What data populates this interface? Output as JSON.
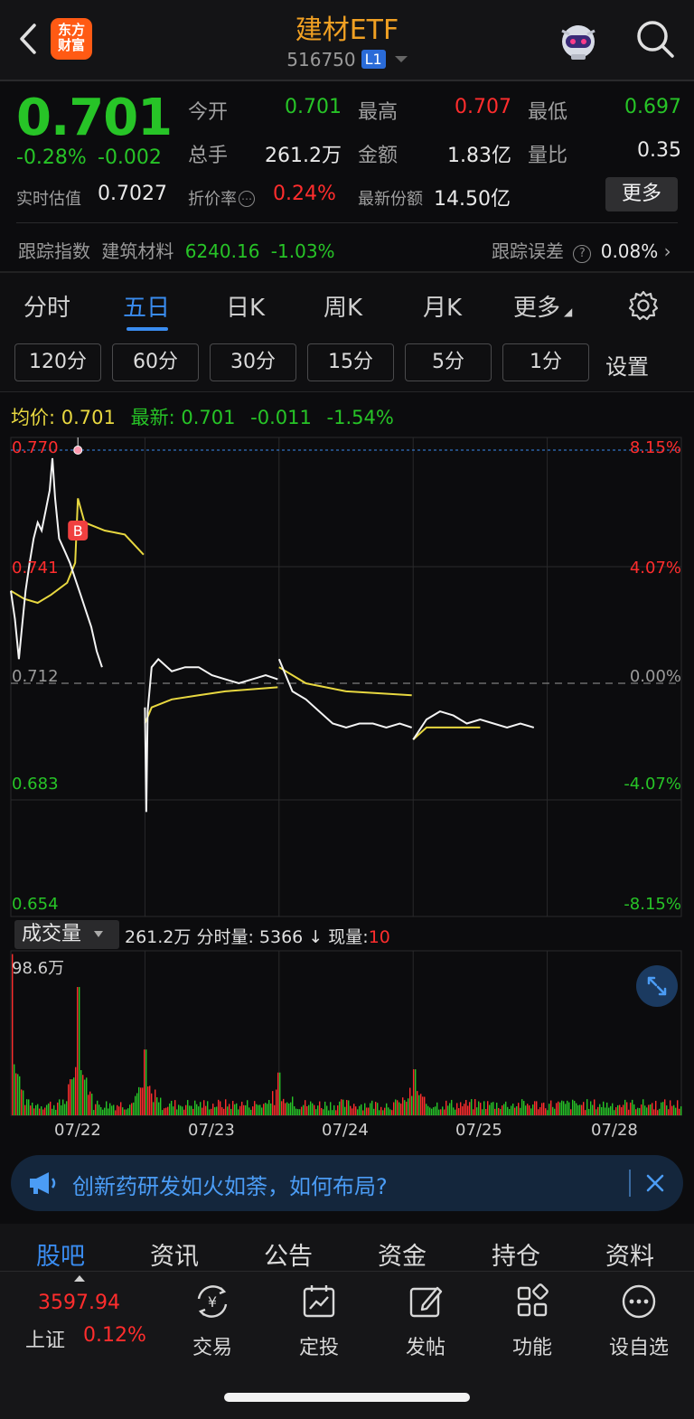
{
  "header": {
    "title": "建材ETF",
    "code": "516750",
    "level_badge": "L1",
    "logo_line1": "东方",
    "logo_line2": "财富"
  },
  "quote": {
    "price": "0.701",
    "change_pct": "-0.28%",
    "change_abs": "-0.002",
    "open_label": "今开",
    "open_value": "0.701",
    "high_label": "最高",
    "high_value": "0.707",
    "low_label": "最低",
    "low_value": "0.697",
    "volume_label": "总手",
    "volume_value": "261.2万",
    "amount_label": "金额",
    "amount_value": "1.83亿",
    "ratio_label": "量比",
    "ratio_value": "0.35",
    "iopv_label": "实时估值",
    "iopv_value": "0.7027",
    "discount_label": "折价率",
    "discount_value": "0.24%",
    "shares_label": "最新份额",
    "shares_value": "14.50亿",
    "more_label": "更多",
    "track_label": "跟踪指数",
    "track_name": "建筑材料",
    "track_value": "6240.16",
    "track_change": "-1.03%",
    "track_error_label": "跟踪误差",
    "track_error_value": "0.08%"
  },
  "tabs": [
    {
      "label": "分时",
      "active": false
    },
    {
      "label": "五日",
      "active": true
    },
    {
      "label": "日K",
      "active": false
    },
    {
      "label": "周K",
      "active": false
    },
    {
      "label": "月K",
      "active": false
    },
    {
      "label": "更多",
      "active": false
    }
  ],
  "periods": [
    "120分",
    "60分",
    "30分",
    "15分",
    "5分",
    "1分"
  ],
  "periods_settings": "设置",
  "legend": {
    "avg_label": "均价:",
    "avg_value": "0.701",
    "last_label": "最新:",
    "last_value": "0.701",
    "last_change": "-0.011",
    "last_pct": "-1.54%"
  },
  "chart_data": {
    "type": "line",
    "dates": [
      "07/22",
      "07/23",
      "07/24",
      "07/25",
      "07/28"
    ],
    "price_ticks": [
      "0.770",
      "0.741",
      "0.712",
      "0.683",
      "0.654"
    ],
    "pct_ticks": [
      "8.15%",
      "4.07%",
      "0.00%",
      "-4.07%",
      "-8.15%"
    ],
    "ylim": [
      0.654,
      0.77
    ],
    "prev_close": 0.712,
    "buy_marker": "B",
    "price_series": [
      [
        0.0,
        0.735
      ],
      [
        0.03,
        0.728
      ],
      [
        0.06,
        0.718
      ],
      [
        0.08,
        0.725
      ],
      [
        0.11,
        0.735
      ],
      [
        0.14,
        0.742
      ],
      [
        0.17,
        0.748
      ],
      [
        0.2,
        0.752
      ],
      [
        0.23,
        0.75
      ],
      [
        0.26,
        0.755
      ],
      [
        0.29,
        0.76
      ],
      [
        0.31,
        0.768
      ],
      [
        0.33,
        0.758
      ],
      [
        0.36,
        0.748
      ],
      [
        0.4,
        0.745
      ],
      [
        0.44,
        0.742
      ],
      [
        0.48,
        0.738
      ],
      [
        0.52,
        0.734
      ],
      [
        0.56,
        0.73
      ],
      [
        0.6,
        0.726
      ],
      [
        0.64,
        0.72
      ],
      [
        0.68,
        0.716
      ],
      [
        1.0,
        0.706
      ],
      [
        1.01,
        0.68
      ],
      [
        1.02,
        0.705
      ],
      [
        1.05,
        0.716
      ],
      [
        1.1,
        0.718
      ],
      [
        1.2,
        0.715
      ],
      [
        1.3,
        0.716
      ],
      [
        1.4,
        0.716
      ],
      [
        1.5,
        0.714
      ],
      [
        1.6,
        0.713
      ],
      [
        1.7,
        0.712
      ],
      [
        1.8,
        0.713
      ],
      [
        1.9,
        0.714
      ],
      [
        1.99,
        0.713
      ],
      [
        2.0,
        0.718
      ],
      [
        2.05,
        0.714
      ],
      [
        2.1,
        0.71
      ],
      [
        2.2,
        0.708
      ],
      [
        2.3,
        0.705
      ],
      [
        2.4,
        0.702
      ],
      [
        2.5,
        0.701
      ],
      [
        2.6,
        0.702
      ],
      [
        2.7,
        0.702
      ],
      [
        2.8,
        0.701
      ],
      [
        2.9,
        0.702
      ],
      [
        2.99,
        0.701
      ],
      [
        3.0,
        0.698
      ],
      [
        3.1,
        0.703
      ],
      [
        3.2,
        0.705
      ],
      [
        3.3,
        0.704
      ],
      [
        3.4,
        0.702
      ],
      [
        3.5,
        0.703
      ],
      [
        3.6,
        0.702
      ],
      [
        3.7,
        0.701
      ],
      [
        3.8,
        0.702
      ],
      [
        3.9,
        0.701
      ],
      [
        4.0,
        0.701
      ]
    ],
    "avg_series": [
      [
        0.0,
        0.735
      ],
      [
        0.1,
        0.733
      ],
      [
        0.2,
        0.732
      ],
      [
        0.3,
        0.734
      ],
      [
        0.42,
        0.737
      ],
      [
        0.48,
        0.742
      ],
      [
        0.5,
        0.758
      ],
      [
        0.55,
        0.752
      ],
      [
        0.7,
        0.75
      ],
      [
        0.85,
        0.749
      ],
      [
        0.99,
        0.744
      ],
      [
        1.0,
        0.702
      ],
      [
        1.05,
        0.706
      ],
      [
        1.2,
        0.708
      ],
      [
        1.4,
        0.709
      ],
      [
        1.6,
        0.71
      ],
      [
        1.99,
        0.711
      ],
      [
        2.0,
        0.716
      ],
      [
        2.2,
        0.712
      ],
      [
        2.5,
        0.71
      ],
      [
        2.99,
        0.709
      ],
      [
        3.0,
        0.698
      ],
      [
        3.1,
        0.701
      ],
      [
        3.5,
        0.701
      ],
      [
        4.0,
        0.701
      ]
    ],
    "volume": {
      "label": "成交量",
      "total": "261.2万",
      "tick_label": "分时量:",
      "tick_value": "5366",
      "arrow": "↓",
      "now_label": "现量:",
      "now_value": "10",
      "max_label": "98.6万",
      "spikes": [
        [
          0.0,
          0.98
        ],
        [
          0.5,
          0.78
        ],
        [
          1.0,
          0.4
        ],
        [
          2.0,
          0.26
        ],
        [
          3.0,
          0.28
        ]
      ]
    }
  },
  "banner": {
    "text": "创新药研发如火如荼，如何布局?"
  },
  "subtabs": [
    {
      "label": "股吧",
      "active": true
    },
    {
      "label": "资讯",
      "active": false
    },
    {
      "label": "公告",
      "active": false
    },
    {
      "label": "资金",
      "active": false
    },
    {
      "label": "持仓",
      "active": false
    },
    {
      "label": "资料",
      "active": false
    }
  ],
  "bottombar": {
    "index_value": "3597.94",
    "index_name": "上证",
    "index_change": "0.12%",
    "items": [
      "交易",
      "定投",
      "发帖",
      "功能",
      "设自选"
    ]
  },
  "colors": {
    "up": "#ff2d2d",
    "down": "#27c427",
    "accent": "#3a8cf0",
    "title": "#f0a023",
    "avg_line": "#e8d840"
  }
}
